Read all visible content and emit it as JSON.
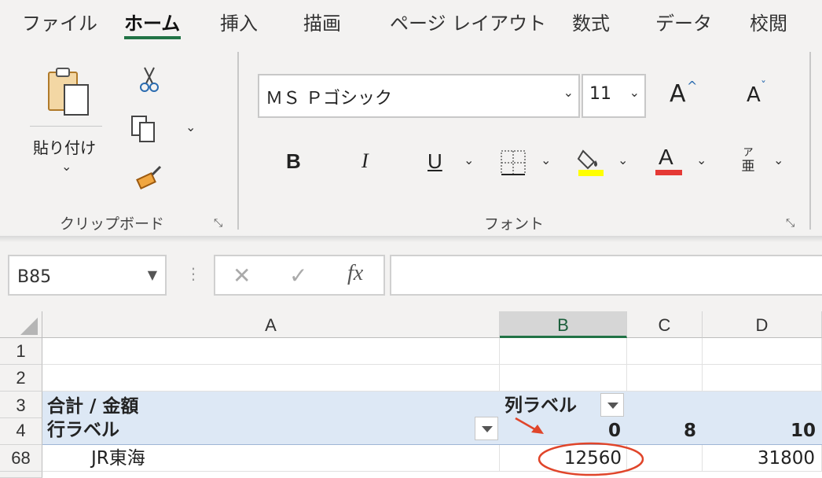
{
  "tabs": [
    {
      "label": "ファイル",
      "active": false
    },
    {
      "label": "ホーム",
      "active": true
    },
    {
      "label": "挿入",
      "active": false
    },
    {
      "label": "描画",
      "active": false
    },
    {
      "label": "ページ レイアウト",
      "active": false
    },
    {
      "label": "数式",
      "active": false
    },
    {
      "label": "データ",
      "active": false
    },
    {
      "label": "校閲",
      "active": false
    }
  ],
  "clipboard": {
    "paste_label": "貼り付け",
    "group_label": "クリップボード"
  },
  "font": {
    "name": "ＭＳ Ｐゴシック",
    "size": "11",
    "group_label": "フォント",
    "bold_glyph": "B",
    "italic_glyph": "I",
    "underline_glyph": "U",
    "font_color_glyph": "A",
    "grow_glyph": "A",
    "shrink_glyph": "A",
    "phonetic_glyph_top": "ア",
    "phonetic_glyph_bottom": "亜",
    "highlight_color": "#ffff00",
    "font_color": "#e53935"
  },
  "formula_bar": {
    "name_box": "B85",
    "fx_label": "fx",
    "formula": ""
  },
  "grid": {
    "columns": [
      "A",
      "B",
      "C",
      "D"
    ],
    "selected_column": "B",
    "rows": [
      {
        "num": "1",
        "a": "",
        "b": "",
        "c": "",
        "d": ""
      },
      {
        "num": "2",
        "a": "",
        "b": "",
        "c": "",
        "d": ""
      },
      {
        "num": "3",
        "a": "合計 / 金額",
        "b": "列ラベル",
        "c": "",
        "d": ""
      },
      {
        "num": "4",
        "a": "行ラベル",
        "b": "0",
        "c": "8",
        "d": "10"
      },
      {
        "num": "68",
        "a": "JR東海",
        "b": "12560",
        "c": "",
        "d": "31800"
      }
    ]
  },
  "colors": {
    "accent": "#217346",
    "pivot_header": "#dde8f5",
    "annotation": "#e0452a"
  }
}
